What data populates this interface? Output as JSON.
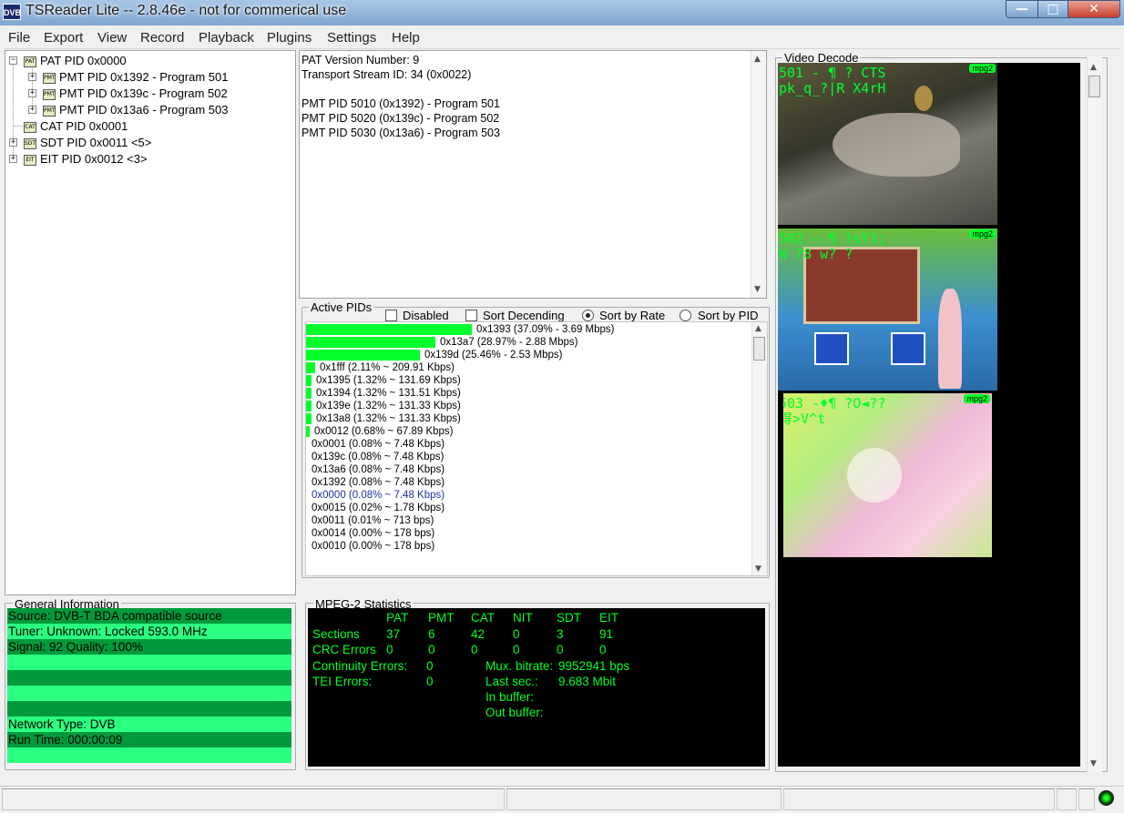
{
  "window": {
    "icon_text": "DVB",
    "title": "TSReader Lite -- 2.8.46e - not for commerical use"
  },
  "menu": [
    "File",
    "Export",
    "View",
    "Record",
    "Playback",
    "Plugins",
    "Settings",
    "Help"
  ],
  "tree": {
    "nodes": [
      {
        "label": "PAT PID 0x0000",
        "icon": "PAT"
      },
      {
        "label": "PMT PID 0x1392 - Program 501",
        "icon": "PMT"
      },
      {
        "label": "PMT PID 0x139c - Program 502",
        "icon": "PMT"
      },
      {
        "label": "PMT PID 0x13a6 - Program 503",
        "icon": "PMT"
      },
      {
        "label": "CAT PID 0x0001",
        "icon": "CAT"
      },
      {
        "label": "SDT PID 0x0011 <5>",
        "icon": "SDT"
      },
      {
        "label": "EIT PID 0x0012 <3>",
        "icon": "EIT"
      }
    ]
  },
  "pat_detail": {
    "lines": [
      "PAT Version Number: 9",
      "Transport Stream ID: 34 (0x0022)",
      "",
      "PMT PID 5010 (0x1392) - Program 501",
      "PMT PID 5020 (0x139c) - Program 502",
      "PMT PID 5030 (0x13a6) - Program 503"
    ]
  },
  "active_pids": {
    "title": "Active PIDs",
    "options": {
      "disabled": {
        "label": "Disabled",
        "checked": false
      },
      "sort_desc": {
        "label": "Sort Decending",
        "checked": false
      },
      "sort_rate": {
        "label": "Sort by Rate",
        "selected": true
      },
      "sort_pid": {
        "label": "Sort by PID",
        "selected": false
      }
    },
    "bar_color": "#00ff2a",
    "rows": [
      {
        "text": "0x1393 (37.09% - 3.69 Mbps)",
        "percent": 37.09
      },
      {
        "text": "0x13a7 (28.97% - 2.88 Mbps)",
        "percent": 28.97
      },
      {
        "text": "0x139d (25.46% - 2.53 Mbps)",
        "percent": 25.46
      },
      {
        "text": "0x1fff (2.11% ~ 209.91 Kbps)",
        "percent": 2.11
      },
      {
        "text": "0x1395 (1.32% ~ 131.69 Kbps)",
        "percent": 1.32
      },
      {
        "text": "0x1394 (1.32% ~ 131.51 Kbps)",
        "percent": 1.32
      },
      {
        "text": "0x139e (1.32% ~ 131.33 Kbps)",
        "percent": 1.32
      },
      {
        "text": "0x13a8 (1.32% ~ 131.33 Kbps)",
        "percent": 1.32
      },
      {
        "text": "0x0012 (0.68% ~ 67.89 Kbps)",
        "percent": 0.68
      },
      {
        "text": "0x0001 (0.08% ~ 7.48 Kbps)",
        "percent": 0.08
      },
      {
        "text": "0x139c (0.08% ~ 7.48 Kbps)",
        "percent": 0.08
      },
      {
        "text": "0x13a6 (0.08% ~ 7.48 Kbps)",
        "percent": 0.08
      },
      {
        "text": "0x1392 (0.08% ~ 7.48 Kbps)",
        "percent": 0.08
      },
      {
        "text": "0x0000 (0.08% ~ 7.48 Kbps)",
        "percent": 0.08,
        "highlight": true
      },
      {
        "text": "0x0015 (0.02% ~ 1.78 Kbps)",
        "percent": 0.02
      },
      {
        "text": "0x0011 (0.01% ~ 713 bps)",
        "percent": 0.01
      },
      {
        "text": "0x0014 (0.00% ~ 178 bps)",
        "percent": 0.0
      },
      {
        "text": "0x0010 (0.00% ~ 178 bps)",
        "percent": 0.0
      }
    ]
  },
  "general_info": {
    "title": "General Information",
    "colors": {
      "light": "#2aff80",
      "dark": "#009a3c"
    },
    "lines": [
      "Source: DVB-T BDA compatible source",
      "Tuner: Unknown: Locked 593.0 MHz",
      "Signal: 92 Quality: 100%",
      "",
      "",
      "",
      "",
      "Network Type: DVB",
      "Run Time: 000:00:09",
      ""
    ]
  },
  "mpeg_stats": {
    "title": "MPEG-2 Statistics",
    "headers": [
      "PAT",
      "PMT",
      "CAT",
      "NIT",
      "SDT",
      "EIT"
    ],
    "sections_label": "Sections",
    "sections": [
      "37",
      "6",
      "42",
      "0",
      "3",
      "91"
    ],
    "crc_label": "CRC Errors",
    "crc": [
      "0",
      "0",
      "0",
      "0",
      "0",
      "0"
    ],
    "continuity_label": "Continuity Errors:",
    "continuity": "0",
    "tei_label": "TEI Errors:",
    "tei": "0",
    "mux_label": "Mux. bitrate:",
    "mux": "9952941 bps",
    "lastsec_label": "Last sec.:",
    "lastsec": "9.683 Mbit",
    "inbuf_label": "In buffer:",
    "outbuf_label": "Out buffer:"
  },
  "video_decode": {
    "title": "Video Decode",
    "thumbs": [
      {
        "line1": "501 - ¶  ? CTS",
        "line2": "pk_q_?|R X4rH",
        "badge": "mpg2"
      },
      {
        "line1": "502 - ¶  ?sY?;",
        "line2": "W   ?8  w?   ?",
        "badge": "mpg2"
      },
      {
        "line1": "503 -♦¶   ?O◄??",
        "line2": "得>V^t",
        "badge": "mpg2"
      }
    ]
  }
}
